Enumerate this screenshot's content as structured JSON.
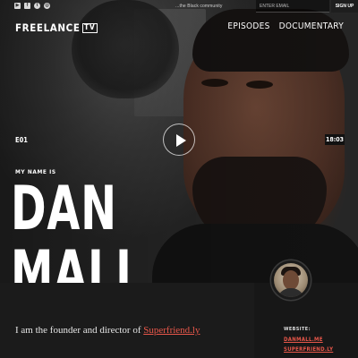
{
  "topbar": {
    "socials": [
      {
        "icon": "youtube-icon",
        "glyph": "▶"
      },
      {
        "icon": "facebook-icon",
        "glyph": "f"
      },
      {
        "icon": "twitter-icon",
        "glyph": "t"
      },
      {
        "icon": "instagram-icon",
        "glyph": "◎"
      }
    ],
    "tagline": "...the Black community",
    "email_placeholder": "ENTER EMAIL",
    "signup_label": "SIGN UP"
  },
  "brand": {
    "name": "FREELANCE",
    "badge": "TV"
  },
  "nav": {
    "episodes": "EPISODES",
    "documentary": "DOCUMENTARY"
  },
  "video": {
    "episode": "E01",
    "duration": "18:03",
    "play_icon": "play-icon"
  },
  "person": {
    "intro": "MY NAME IS",
    "first_name": "DAN",
    "last_name": "MALL",
    "bio_prefix": "I am the founder and director of ",
    "bio_link": "Superfriend.ly"
  },
  "website": {
    "label": "WEBSITE:",
    "links": [
      "DANMALL.ME",
      "SUPERFRIEND.LY"
    ]
  },
  "colors": {
    "accent": "#e8574a",
    "band": "#1b1b1b"
  }
}
